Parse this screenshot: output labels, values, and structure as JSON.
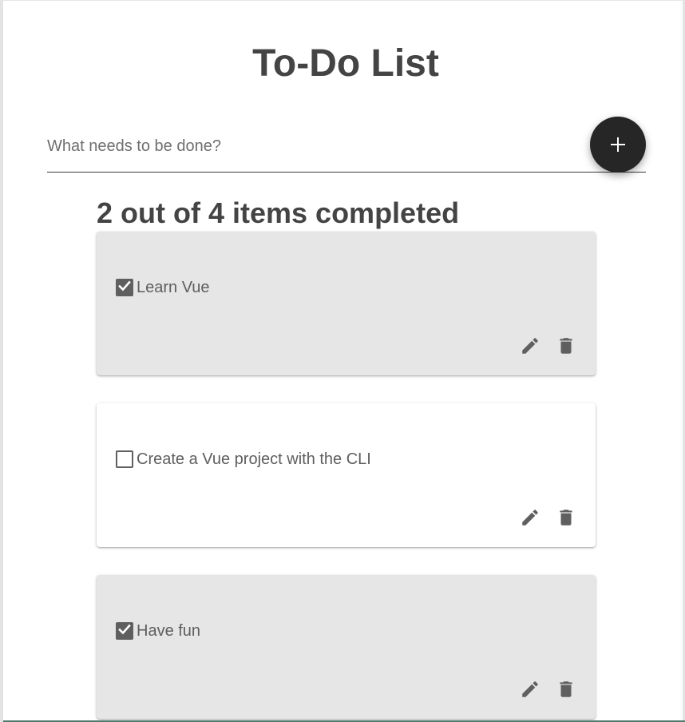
{
  "app": {
    "title": "To-Do List"
  },
  "input": {
    "placeholder": "What needs to be done?",
    "value": ""
  },
  "add_button": {
    "icon": "plus-icon",
    "label": "+"
  },
  "summary": "2 out of 4 items completed",
  "items": [
    {
      "label": "Learn Vue",
      "completed": true
    },
    {
      "label": "Create a Vue project with the CLI",
      "completed": false
    },
    {
      "label": "Have fun",
      "completed": true
    }
  ],
  "icons": {
    "edit": "pencil-icon",
    "delete": "trash-icon"
  },
  "colors": {
    "completed_card": "#e6e6e6",
    "open_card": "#ffffff",
    "fab": "#262626",
    "text": "#444444"
  }
}
